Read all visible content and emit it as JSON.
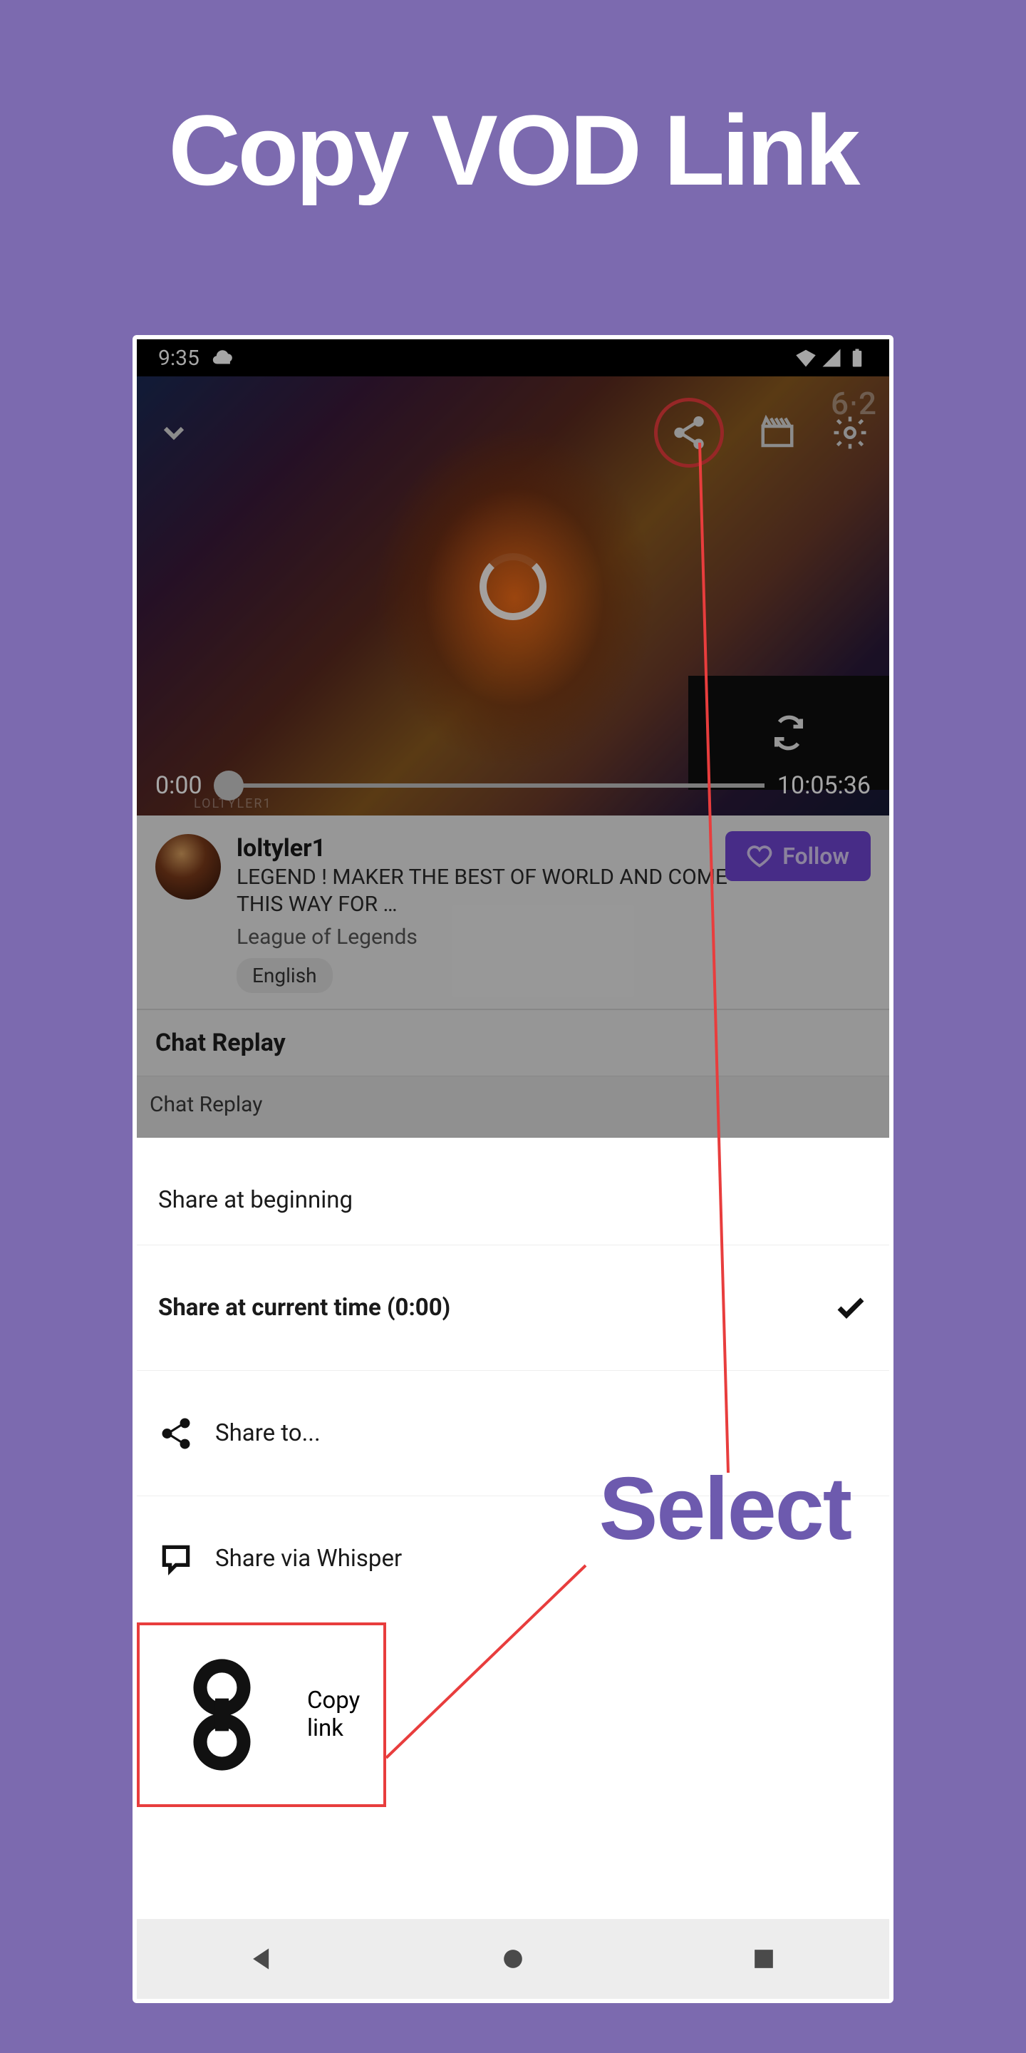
{
  "page_title": "Copy VOD Link",
  "select_label": "Select",
  "status_bar": {
    "time": "9:35"
  },
  "video": {
    "quality_label": "6⋅2",
    "current_time": "0:00",
    "total_time": "10:05:36",
    "watermark": "LOLTYLER1"
  },
  "info": {
    "channel_name": "loltyler1",
    "stream_title": "LEGEND ! MAKER THE BEST OF WORLD AND COME THIS WAY FOR …",
    "game_name": "League of Legends",
    "tag": "English",
    "follow_label": "Follow"
  },
  "chat": {
    "header": "Chat Replay",
    "body": "Chat Replay"
  },
  "sheet": {
    "share_beginning": "Share at beginning",
    "share_current": "Share at current time (0:00)",
    "share_to": "Share to...",
    "share_whisper": "Share via Whisper",
    "copy_link": "Copy link"
  },
  "colors": {
    "background": "#7c6aaf",
    "accent": "#6d44d0",
    "annotation_red": "#e83d3d",
    "annotation_purple": "#6d5aae"
  }
}
